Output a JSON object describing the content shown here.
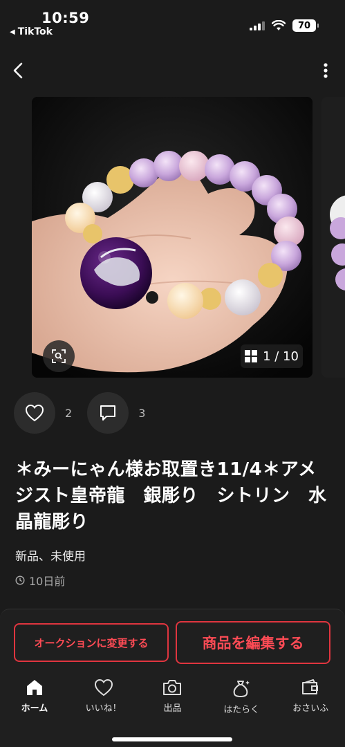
{
  "status_bar": {
    "time": "10:59",
    "back_app": "TikTok",
    "battery": "70"
  },
  "icons": {
    "back": "chevron-left-icon",
    "more": "vertical-dots-icon",
    "lens": "image-search-icon",
    "gallery": "grid-icon",
    "like": "heart-icon",
    "comment": "comment-icon",
    "clock": "clock-icon"
  },
  "carousel": {
    "counter": "1 / 10",
    "current": 1,
    "total": 10
  },
  "actions": {
    "likes": "2",
    "comments": "3"
  },
  "item": {
    "title": "＊みーにゃん様お取置き11/4＊アメジスト皇帝龍　銀彫り　シトリン　水晶龍彫り",
    "condition": "新品、未使用",
    "posted": "10日前"
  },
  "buttons": {
    "auction": "オークションに変更する",
    "edit": "商品を編集する"
  },
  "tabs": [
    {
      "label": "ホーム",
      "icon": "home-icon"
    },
    {
      "label": "いいね！",
      "icon": "heart-icon"
    },
    {
      "label": "出品",
      "icon": "camera-icon"
    },
    {
      "label": "はたらく",
      "icon": "money-bag-icon"
    },
    {
      "label": "おさいふ",
      "icon": "wallet-icon"
    }
  ],
  "colors": {
    "accent": "#e0353f",
    "background": "#1b1b1b"
  }
}
